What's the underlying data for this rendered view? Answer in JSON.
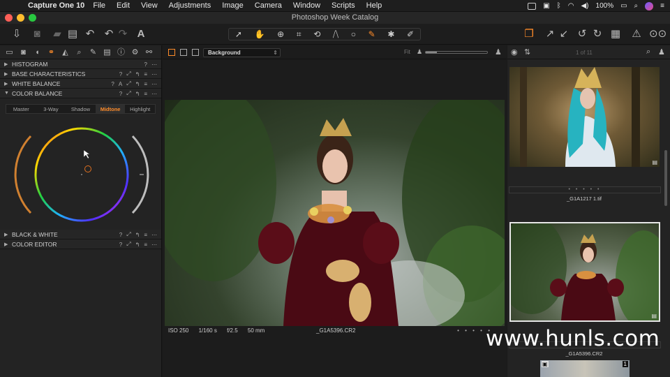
{
  "menubar": {
    "app": "Capture One 10",
    "items": [
      "File",
      "Edit",
      "View",
      "Adjustments",
      "Image",
      "Camera",
      "Window",
      "Scripts",
      "Help"
    ],
    "battery": "100%"
  },
  "window": {
    "title": "Photoshop Week Catalog"
  },
  "tool_tabs_active": "color",
  "sections": {
    "histogram": "HISTOGRAM",
    "base": "BASE CHARACTERISTICS",
    "white_balance": "WHITE BALANCE",
    "color_balance": "COLOR BALANCE",
    "black_white": "BLACK & WHITE",
    "color_editor": "COLOR EDITOR"
  },
  "color_balance_tabs": [
    "Master",
    "3-Way",
    "Shadow",
    "Midtone",
    "Highlight"
  ],
  "color_balance_active": "Midtone",
  "viewer": {
    "layer": "Background",
    "fit": "Fit",
    "zoom_level": 0.18,
    "iso": "ISO 250",
    "shutter": "1/160 s",
    "aperture": "f/2.5",
    "focal": "50 mm",
    "filename": "_G1A5396.CR2",
    "rating": "• • • • •"
  },
  "browser": {
    "count": "1 of 11",
    "thumbs": [
      {
        "name": "_G1A1217 1.tif",
        "rating": "• • • • •"
      },
      {
        "name": "_G1A5396.CR2",
        "rating": ""
      }
    ],
    "third_badge": "1"
  },
  "watermark": "www.hunls.com",
  "colors": {
    "accent": "#ff8c2a",
    "selected_border": "#e6e6e6"
  }
}
